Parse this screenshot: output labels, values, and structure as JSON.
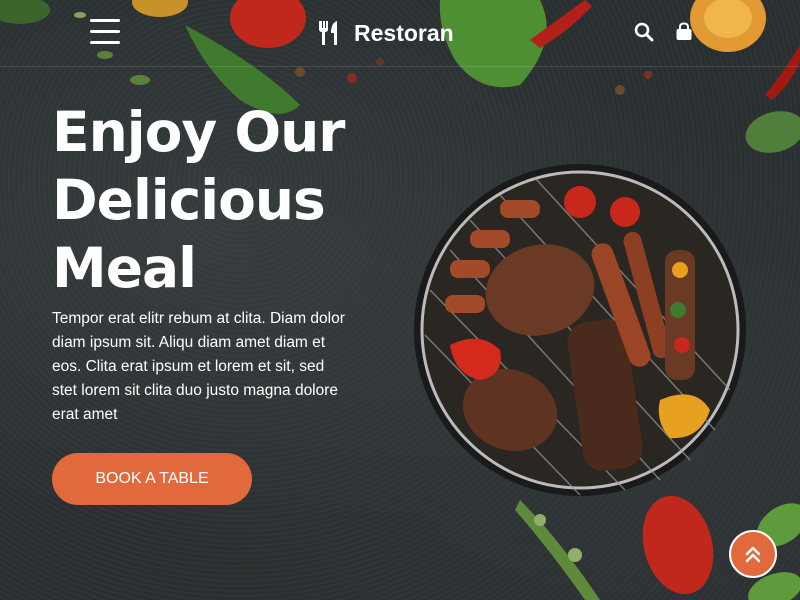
{
  "header": {
    "brand": "Restoran",
    "icons": [
      "menu-icon",
      "utensils-icon",
      "search-icon",
      "shopping-bag-icon"
    ]
  },
  "hero": {
    "title_lines": [
      "Enjoy Our",
      "Delicious",
      "Meal"
    ],
    "description": "Tempor erat elitr rebum at clita. Diam dolor diam ipsum sit. Aliqu diam amet diam et eos. Clita erat ipsum et lorem et sit, sed stet lorem sit clita duo justo magna dolore erat amet",
    "cta_label": "BOOK A TABLE"
  },
  "colors": {
    "accent": "#e2693b",
    "background": "#2a2f31",
    "text": "#ffffff"
  }
}
